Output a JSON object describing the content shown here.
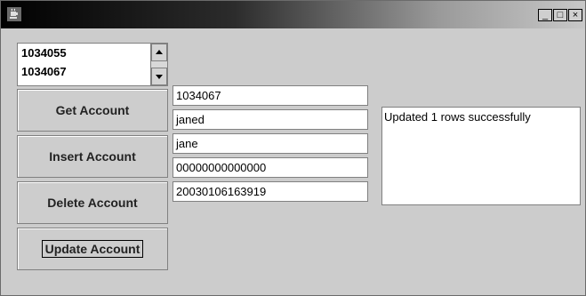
{
  "window": {
    "title": "",
    "controls": {
      "minimize": "_",
      "maximize": "□",
      "close": "×"
    }
  },
  "account_list": {
    "items": [
      "1034055",
      "1034067"
    ]
  },
  "buttons": {
    "get": "Get Account",
    "insert": "Insert Account",
    "delete": "Delete Account",
    "update": "Update Account"
  },
  "fields": {
    "account_id": "1034067",
    "username": "janed",
    "first_name": "jane",
    "number": "00000000000000",
    "timestamp": "20030106163919"
  },
  "status_output": "Updated 1 rows successfully",
  "icons": {
    "app": "java-coffee-cup-icon",
    "scroll_up": "arrow-up-icon",
    "scroll_down": "arrow-down-icon"
  }
}
